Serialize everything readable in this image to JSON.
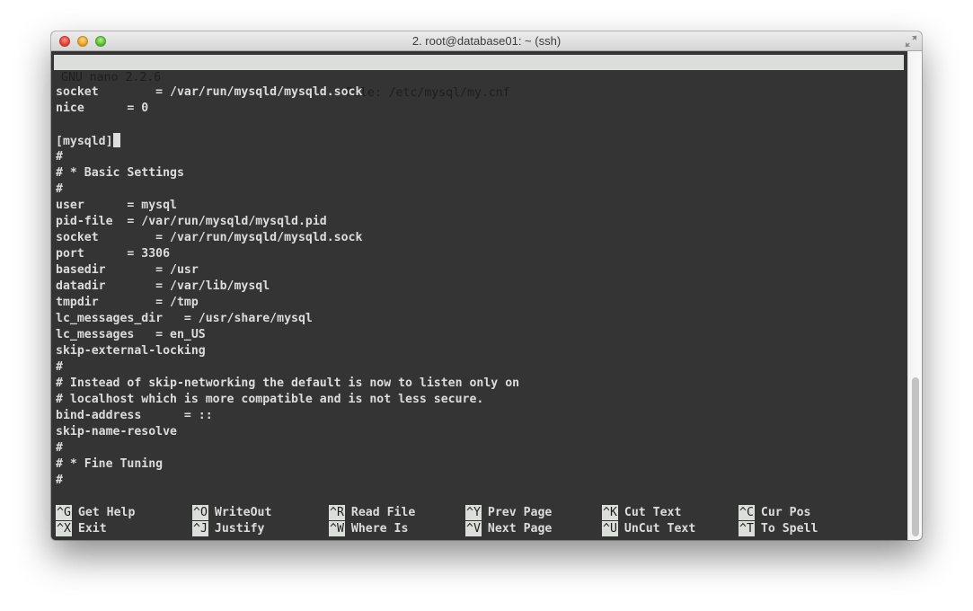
{
  "window": {
    "title": "2. root@database01: ~ (ssh)"
  },
  "nano": {
    "version": "GNU nano 2.2.6",
    "file": "File: /etc/mysql/my.cnf"
  },
  "editor": {
    "lines": [
      "socket        = /var/run/mysqld/mysqld.sock",
      "nice      = 0",
      "",
      "[mysqld]",
      "#",
      "# * Basic Settings",
      "#",
      "user      = mysql",
      "pid-file  = /var/run/mysqld/mysqld.pid",
      "socket        = /var/run/mysqld/mysqld.sock",
      "port      = 3306",
      "basedir       = /usr",
      "datadir       = /var/lib/mysql",
      "tmpdir        = /tmp",
      "lc_messages_dir   = /usr/share/mysql",
      "lc_messages   = en_US",
      "skip-external-locking",
      "#",
      "# Instead of skip-networking the default is now to listen only on",
      "# localhost which is more compatible and is not less secure.",
      "bind-address      = ::",
      "skip-name-resolve",
      "#",
      "# * Fine Tuning",
      "#"
    ],
    "cursor_line": 3
  },
  "shortcuts": [
    {
      "key": "^G",
      "label": "Get Help"
    },
    {
      "key": "^O",
      "label": "WriteOut"
    },
    {
      "key": "^R",
      "label": "Read File"
    },
    {
      "key": "^Y",
      "label": "Prev Page"
    },
    {
      "key": "^K",
      "label": "Cut Text"
    },
    {
      "key": "^C",
      "label": "Cur Pos"
    },
    {
      "key": "^X",
      "label": "Exit"
    },
    {
      "key": "^J",
      "label": "Justify"
    },
    {
      "key": "^W",
      "label": "Where Is"
    },
    {
      "key": "^V",
      "label": "Next Page"
    },
    {
      "key": "^U",
      "label": "UnCut Text"
    },
    {
      "key": "^T",
      "label": "To Spell"
    }
  ],
  "scrollbar": {
    "position_fraction": 0.67,
    "visible_fraction": 0.33
  }
}
